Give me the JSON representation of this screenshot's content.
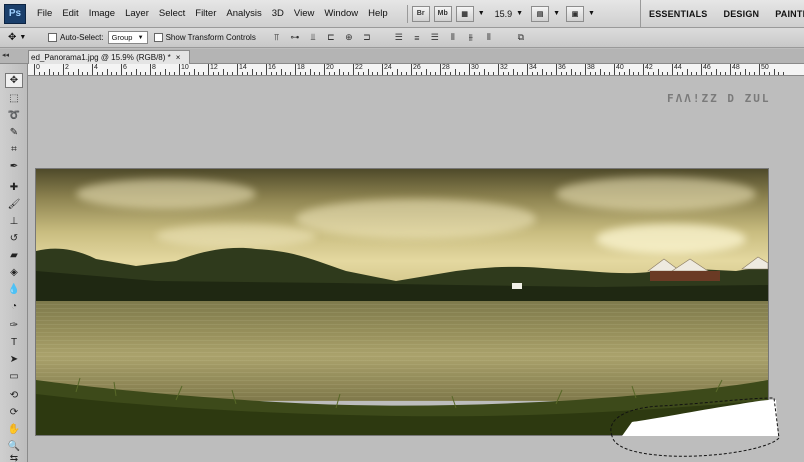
{
  "menubar": {
    "logo": "Ps",
    "items": [
      "File",
      "Edit",
      "Image",
      "Layer",
      "Select",
      "Filter",
      "Analysis",
      "3D",
      "View",
      "Window",
      "Help"
    ],
    "bridge_label": "Br",
    "minibridge_label": "Mb",
    "zoom": "15.9",
    "workspaces": [
      "ESSENTIALS",
      "DESIGN",
      "PAINTING"
    ]
  },
  "options": {
    "auto_select_label": "Auto-Select:",
    "auto_select_value": "Group",
    "show_transform_label": "Show Transform Controls"
  },
  "document": {
    "tab_title": "ed_Panorama1.jpg @ 15.9% (RGB/8) *",
    "close": "×"
  },
  "ruler": {
    "labels": [
      "0",
      "2",
      "4",
      "6",
      "8",
      "10",
      "12",
      "14",
      "16",
      "18",
      "20",
      "22",
      "24",
      "26",
      "28",
      "30",
      "32",
      "34",
      "36",
      "38",
      "40",
      "42",
      "44",
      "46",
      "48",
      "50"
    ]
  },
  "watermark": "FΛΛ!ZZ D ZUL",
  "colors": {
    "accent": "#1b3f6b",
    "chrome": "#d6d6d6",
    "canvas_bg": "#bdbdbd"
  }
}
